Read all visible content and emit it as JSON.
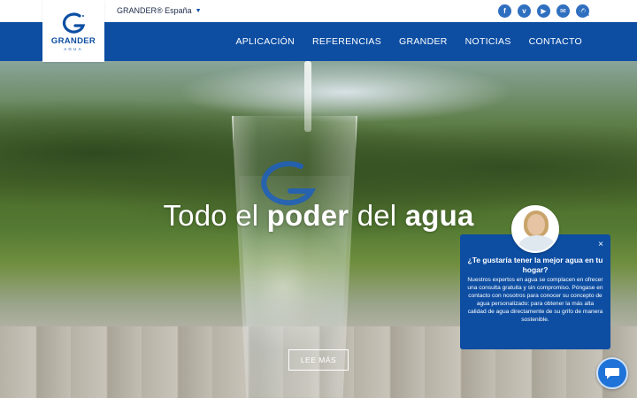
{
  "topbar": {
    "language_label": "GRANDER® España",
    "social": [
      {
        "icon": "facebook-icon",
        "glyph": "f"
      },
      {
        "icon": "vimeo-icon",
        "glyph": "v"
      },
      {
        "icon": "youtube-icon",
        "glyph": "▶"
      },
      {
        "icon": "email-icon",
        "glyph": "✉"
      },
      {
        "icon": "phone-icon",
        "glyph": "✆"
      }
    ]
  },
  "logo": {
    "wordmark": "GRANDER",
    "subtitle": "AGUA"
  },
  "nav": {
    "items": [
      "APLICACIÓN",
      "REFERENCIAS",
      "GRANDER",
      "NOTICIAS",
      "CONTACTO"
    ]
  },
  "hero": {
    "headline_prefix": "Todo el ",
    "headline_bold1": "poder",
    "headline_mid": " del ",
    "headline_bold2": "agua",
    "cta_label": "LEE MÁS"
  },
  "chat": {
    "close_glyph": "×",
    "question": "¿Te gustaría tener la mejor agua en tu hogar?",
    "body": "Nuestros expertos en agua se complacen en ofrecer una consulta gratuita y sin compromiso. Póngase en contacto con nosotros para conocer su concepto de agua personalizado: para obtener la más alta calidad de agua directamente de su grifo de manera sostenible."
  },
  "colors": {
    "brand_blue": "#0d4ea3",
    "chat_button": "#1f73d8",
    "social_icon": "#2f6fbf"
  }
}
